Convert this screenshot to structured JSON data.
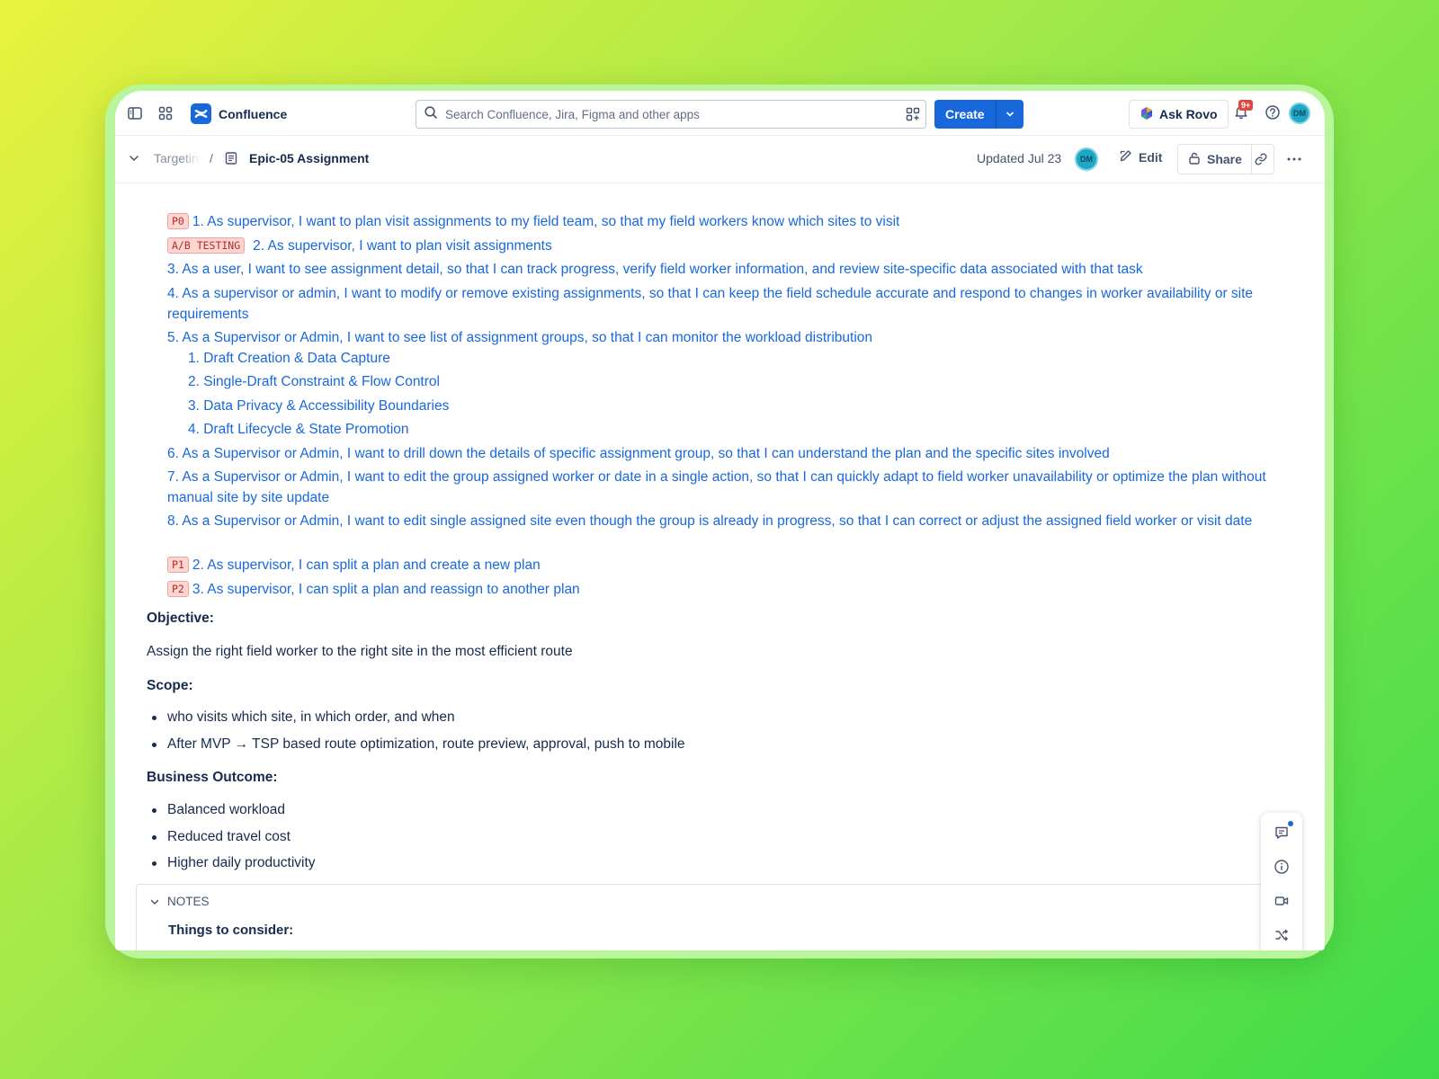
{
  "app": {
    "name": "Confluence"
  },
  "search": {
    "placeholder": "Search Confluence, Jira, Figma and other apps"
  },
  "toolbar": {
    "create_label": "Create",
    "ask_rovo_label": "Ask Rovo",
    "notification_count": "9+",
    "avatar_initials": "DM"
  },
  "breadcrumb": {
    "parent": "Targeting",
    "separator": "/",
    "current": "Epic-05 Assignment"
  },
  "page_meta": {
    "updated": "Updated Jul 23",
    "author_initials": "DM",
    "edit_label": "Edit",
    "share_label": "Share"
  },
  "stories": [
    {
      "badge": "P0",
      "text": "1. As supervisor, I want to plan visit assignments to my field team, so that my field workers know which sites to visit"
    },
    {
      "badge": "A/B TESTING",
      "text": "2. As supervisor, I want to plan visit assignments"
    },
    {
      "badge": "",
      "text": "3. As a user, I want to see assignment detail, so that I can track progress, verify field worker information, and review site-specific data associated with that task"
    },
    {
      "badge": "",
      "text": "4. As a supervisor or admin, I want to modify or remove existing assignments, so that I can keep the field schedule accurate and respond to changes in worker availability or site requirements"
    },
    {
      "badge": "",
      "text": "5. As a Supervisor or Admin, I want to see list of assignment groups, so that I can monitor the workload distribution"
    },
    {
      "badge": "",
      "text": "6. As a Supervisor or Admin, I want to drill down the details of specific assignment group, so that I can understand the plan and the specific sites involved"
    },
    {
      "badge": "",
      "text": "7. As a Supervisor or Admin, I want to edit the group assigned worker or date in a single action, so that I can quickly adapt to field worker unavailability or optimize the plan without manual site by site update"
    },
    {
      "badge": "",
      "text": "8. As a Supervisor or Admin, I want to edit single assigned site even though the group is already in progress, so that I can correct or adjust the assigned field worker or visit date"
    },
    {
      "badge": "P1",
      "text": "2. As supervisor, I can split a plan and create a new plan"
    },
    {
      "badge": "P2",
      "text": "3. As supervisor, I can split a plan and reassign to another plan"
    }
  ],
  "sub_items": [
    "1. Draft Creation & Data Capture",
    "2. Single-Draft Constraint & Flow Control",
    "3. Data Privacy & Accessibility Boundaries",
    "4. Draft Lifecycle & State Promotion"
  ],
  "objective": {
    "heading": "Objective:",
    "text": "Assign the right field worker to the right site in the most efficient route"
  },
  "scope": {
    "heading": "Scope:",
    "items": [
      "who visits which site, in which order, and when",
      "After MVP → TSP based route optimization, route preview, approval, push to mobile"
    ]
  },
  "business_outcome": {
    "heading": "Business Outcome:",
    "items": [
      "Balanced workload",
      "Reduced travel cost",
      "Higher daily productivity"
    ]
  },
  "notes": {
    "label": "NOTES",
    "subheading": "Things to consider:"
  },
  "colors": {
    "brand": "#1868db",
    "link": "#1868db",
    "badge_bg": "#ffd5d2",
    "badge_text": "#ae2e24"
  }
}
